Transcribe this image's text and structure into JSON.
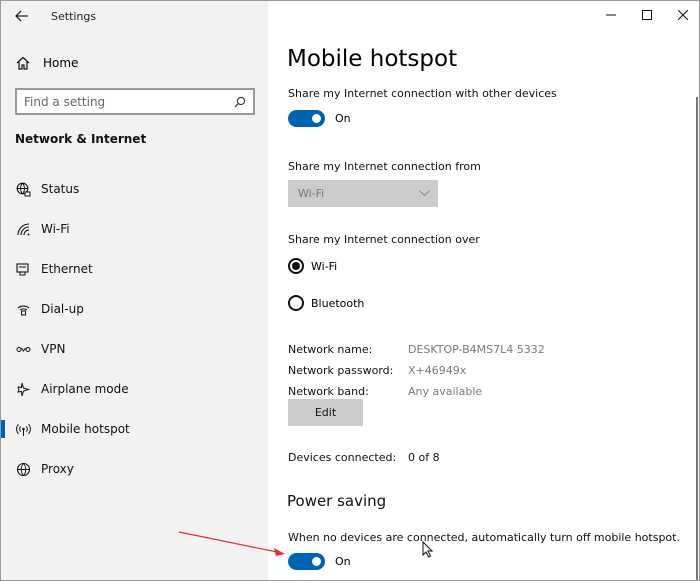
{
  "window": {
    "title": "Settings"
  },
  "sidebar": {
    "home_label": "Home",
    "search_placeholder": "Find a setting",
    "section_title": "Network & Internet",
    "items": [
      {
        "label": "Status",
        "icon": "globe-status-icon"
      },
      {
        "label": "Wi-Fi",
        "icon": "wifi-icon"
      },
      {
        "label": "Ethernet",
        "icon": "ethernet-icon"
      },
      {
        "label": "Dial-up",
        "icon": "dialup-icon"
      },
      {
        "label": "VPN",
        "icon": "vpn-icon"
      },
      {
        "label": "Airplane mode",
        "icon": "airplane-icon"
      },
      {
        "label": "Mobile hotspot",
        "icon": "hotspot-icon",
        "active": true
      },
      {
        "label": "Proxy",
        "icon": "globe-icon"
      }
    ]
  },
  "main": {
    "title": "Mobile hotspot",
    "share_label": "Share my Internet connection with other devices",
    "share_state": "On",
    "from_label": "Share my Internet connection from",
    "from_value": "Wi-Fi",
    "over_label": "Share my Internet connection over",
    "over_options": [
      "Wi-Fi",
      "Bluetooth"
    ],
    "over_selected": "Wi-Fi",
    "network_name_label": "Network name:",
    "network_name": "DESKTOP-B4MS7L4 5332",
    "network_password_label": "Network password:",
    "network_password": "X+46949x",
    "network_band_label": "Network band:",
    "network_band": "Any available",
    "edit_label": "Edit",
    "devices_label": "Devices connected:",
    "devices_value": "0 of 8",
    "power_title": "Power saving",
    "power_desc": "When no devices are connected, automatically turn off mobile hotspot.",
    "power_state": "On"
  },
  "colors": {
    "accent": "#0063b1",
    "annotation_arrow": "#e03030"
  }
}
